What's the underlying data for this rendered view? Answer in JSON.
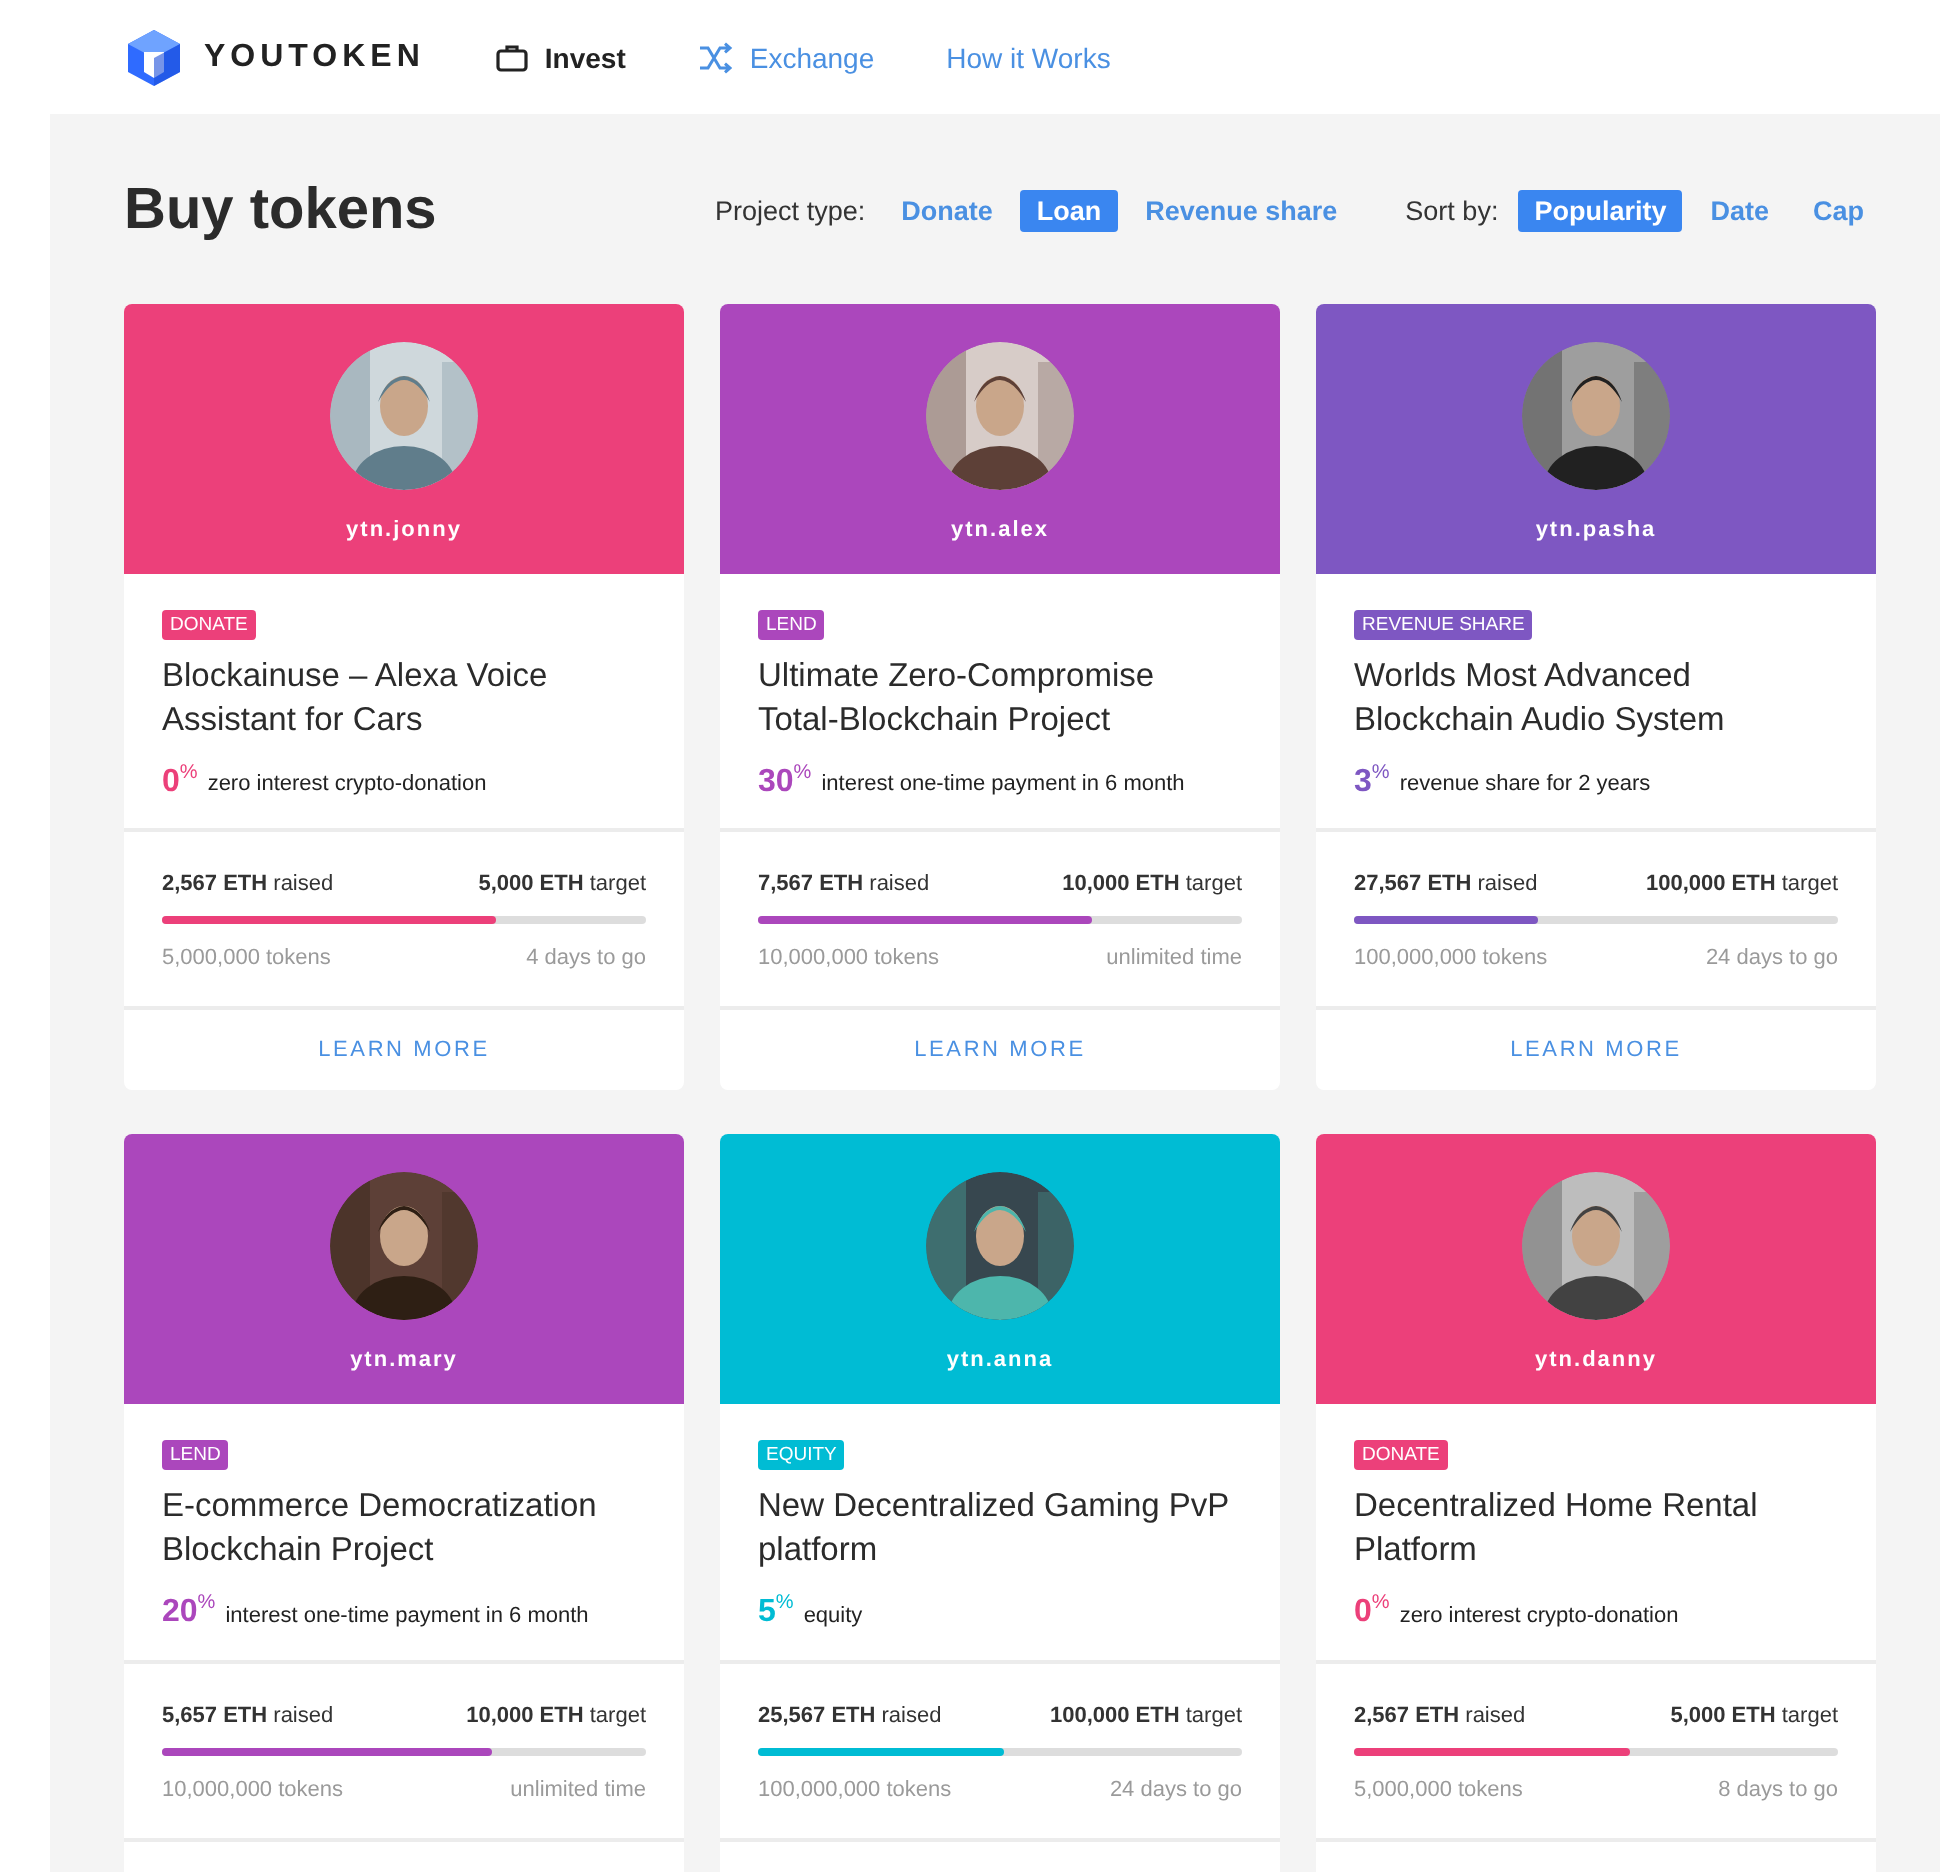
{
  "header": {
    "logo": "YOUTOKEN",
    "nav": [
      {
        "label": "Invest",
        "kind": "briefcase",
        "selected": true
      },
      {
        "label": "Exchange",
        "kind": "shuffle",
        "selected": false
      },
      {
        "label": "How it Works",
        "kind": "text",
        "selected": false
      }
    ]
  },
  "page": {
    "title": "Buy tokens",
    "project_type": {
      "label": "Project type:",
      "options": [
        {
          "label": "Donate",
          "selected": false
        },
        {
          "label": "Loan",
          "selected": true
        },
        {
          "label": "Revenue share",
          "selected": false
        }
      ]
    },
    "sort_by": {
      "label": "Sort by:",
      "options": [
        {
          "label": "Popularity",
          "selected": true
        },
        {
          "label": "Date",
          "selected": false
        },
        {
          "label": "Cap",
          "selected": false
        }
      ]
    }
  },
  "cards": [
    {
      "user": "ytn.jonny",
      "color": "#ec407a",
      "badge": "DONATE",
      "title": "Blockainuse – Alexa Voice Assistant for Cars",
      "rate": "0",
      "rate_unit": "%",
      "rate_text": "zero interest crypto-donation",
      "raised": "**2,567 ETH** raised",
      "target": "**5,000 ETH** target",
      "level": 0.69,
      "tokens": "5,000,000 tokens",
      "time": "4 days to go",
      "action": "LEARN MORE"
    },
    {
      "user": "ytn.alex",
      "color": "#ab47bc",
      "badge": "LEND",
      "title": "Ultimate Zero-Compromise Total-Blockchain Project",
      "rate": "30",
      "rate_unit": "%",
      "rate_text": "interest one-time payment in 6 month",
      "raised": "**7,567 ETH** raised",
      "target": "**10,000 ETH** target",
      "level": 0.69,
      "tokens": "10,000,000 tokens",
      "time": "unlimited time",
      "action": "LEARN MORE"
    },
    {
      "user": "ytn.pasha",
      "color": "#7e57c2",
      "badge": "REVENUE SHARE",
      "title": "Worlds Most Advanced Blockchain Audio System",
      "rate": "3",
      "rate_unit": "%",
      "rate_text": "revenue share for 2 years",
      "raised": "**27,567 ETH** raised",
      "target": "**100,000 ETH** target",
      "level": 0.38,
      "tokens": "100,000,000 tokens",
      "time": "24 days to go",
      "action": "LEARN MORE"
    },
    {
      "user": "ytn.mary",
      "color": "#ab47bc",
      "badge": "LEND",
      "title": "E-commerce Democratization Blockchain Project",
      "rate": "20",
      "rate_unit": "%",
      "rate_text": "interest one-time payment in 6 month",
      "raised": "**5,657 ETH** raised",
      "target": "**10,000 ETH** target",
      "level": 0.68,
      "tokens": "10,000,000 tokens",
      "time": "unlimited time"
    },
    {
      "user": "ytn.anna",
      "color": "#00bcd4",
      "badge": "EQUITY",
      "title": "New Decentralized Gaming PvP platform",
      "rate": "5",
      "rate_unit": "%",
      "rate_text": "equity",
      "raised": "**25,567 ETH** raised",
      "target": "**100,000 ETH** target",
      "level": 0.51,
      "tokens": "100,000,000 tokens",
      "time": "24 days to go"
    },
    {
      "user": "ytn.danny",
      "color": "#ec407a",
      "badge": "DONATE",
      "title": "Decentralized Home Rental Platform",
      "rate": "0",
      "rate_unit": "%",
      "rate_text": "zero interest crypto-donation",
      "raised": "**2,567 ETH** raised",
      "target": "**5,000 ETH** target",
      "level": 0.57,
      "tokens": "5,000,000 tokens",
      "time": "8 days to go"
    }
  ]
}
